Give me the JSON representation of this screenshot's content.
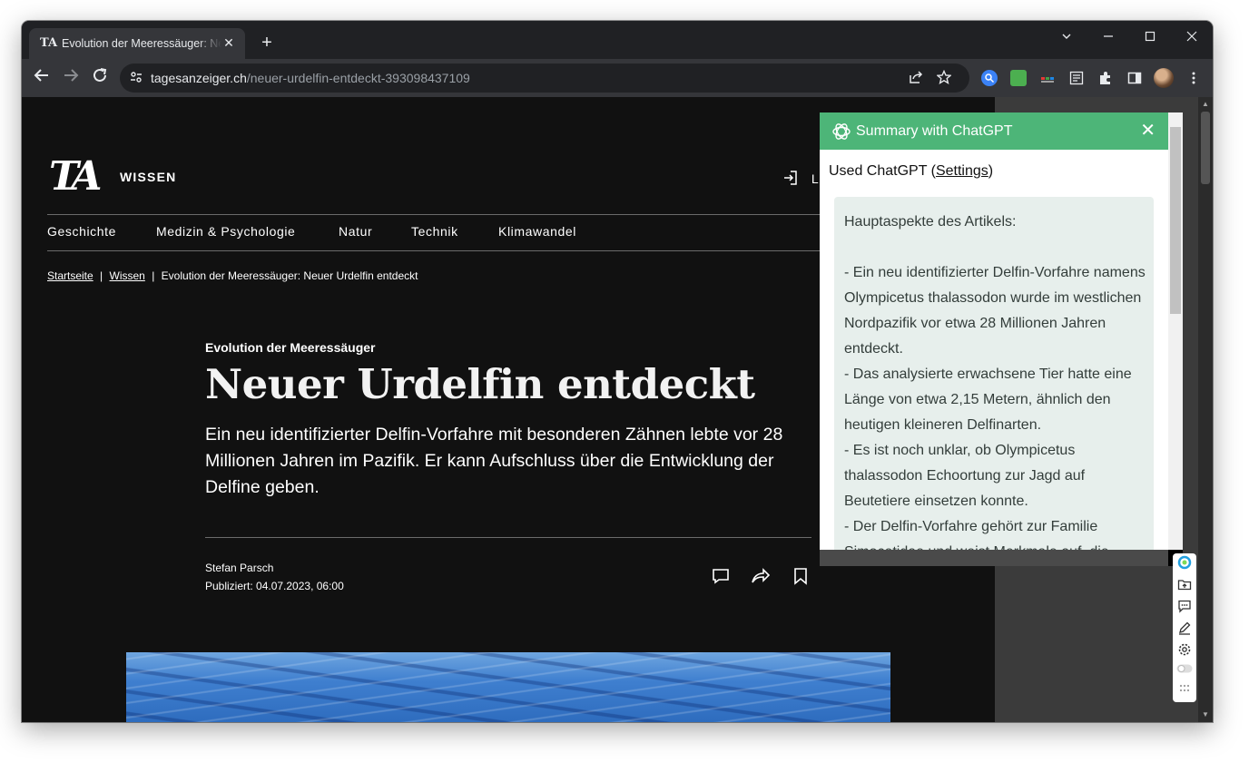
{
  "browser": {
    "tab": {
      "title": "Evolution der Meeressäuger: Neuer Urdelfin entdeckt",
      "favicon": "TA",
      "close": "✕"
    },
    "new_tab": "+",
    "url_host": "tagesanzeiger.ch",
    "url_path": "/neuer-urdelfin-entdeckt-393098437109"
  },
  "site": {
    "logo": "TA",
    "section": "WISSEN",
    "login": "L",
    "nav": [
      "Geschichte",
      "Medizin & Psychologie",
      "Natur",
      "Technik",
      "Klimawandel"
    ],
    "breadcrumb": {
      "home": "Startseite",
      "sep": "|",
      "section": "Wissen",
      "current": "Evolution der Meeressäuger: Neuer Urdelfin entdeckt"
    }
  },
  "article": {
    "kicker": "Evolution der Meeressäuger",
    "headline": "Neuer Urdelfin entdeckt",
    "lead": "Ein neu identifizierter Delfin-Vorfahre mit besonderen Zähnen lebte vor 28 Millionen Jahren im Pazifik. Er kann Aufschluss über die Entwicklung der Delfine geben.",
    "author": "Stefan Parsch",
    "published": "Publiziert: 04.07.2023, 06:00"
  },
  "summary_popup": {
    "title": "Summary with ChatGPT",
    "close": "✕",
    "used_prefix": "Used ChatGPT (",
    "settings_link": "Settings",
    "used_suffix": ")",
    "heading": "Hauptaspekte des Artikels:",
    "points": [
      "- Ein neu identifizierter Delfin-Vorfahre namens Olympicetus thalassodon wurde im westlichen Nordpazifik vor etwa 28 Millionen Jahren entdeckt.",
      "- Das analysierte erwachsene Tier hatte eine Länge von etwa 2,15 Metern, ähnlich den heutigen kleineren Delfinarten.",
      "- Es ist noch unklar, ob Olympicetus thalassodon Echoortung zur Jagd auf Beutetiere einsetzen konnte.",
      "- Der Delfin-Vorfahre gehört zur Familie Simocetidae und weist Merkmale auf, die"
    ]
  },
  "icons": {
    "back": "arrow-left-icon",
    "forward": "arrow-right-icon",
    "reload": "reload-icon",
    "share": "share-icon",
    "bookmark": "star-icon",
    "extensions": "puzzle-icon",
    "comment": "comment-icon",
    "save": "bookmark-icon"
  },
  "colors": {
    "popup_header": "#4db578",
    "page_bg": "#111111",
    "summary_bg": "#e7efec"
  }
}
